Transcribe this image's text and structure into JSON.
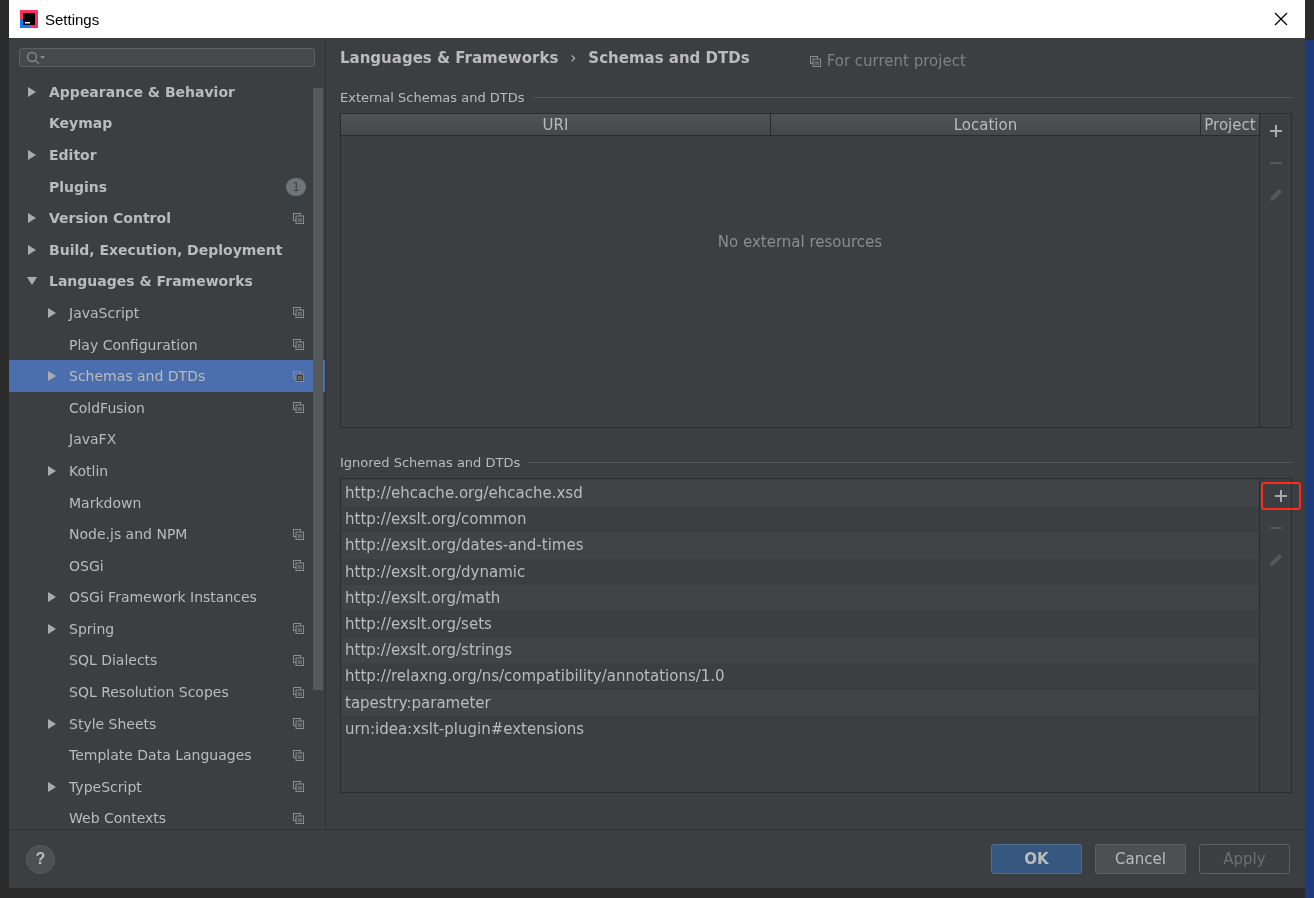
{
  "window": {
    "title": "Settings"
  },
  "sidebar": {
    "items": [
      {
        "label": "Appearance & Behavior",
        "expanded": false,
        "selected": false
      },
      {
        "label": "Keymap",
        "selected": false
      },
      {
        "label": "Editor",
        "expanded": false,
        "selected": false
      },
      {
        "label": "Plugins",
        "badge": "1",
        "selected": false
      },
      {
        "label": "Version Control",
        "expanded": false,
        "selected": false,
        "project_scope": true
      },
      {
        "label": "Build, Execution, Deployment",
        "expanded": false,
        "selected": false
      },
      {
        "label": "Languages & Frameworks",
        "expanded": true,
        "selected": false,
        "children": [
          {
            "label": "JavaScript",
            "expanded": false,
            "selected": false,
            "project_scope": true
          },
          {
            "label": "Play Configuration",
            "selected": false,
            "project_scope": true
          },
          {
            "label": "Schemas and DTDs",
            "expanded": false,
            "selected": true,
            "project_scope": true
          },
          {
            "label": "ColdFusion",
            "selected": false,
            "project_scope": true
          },
          {
            "label": "JavaFX",
            "selected": false
          },
          {
            "label": "Kotlin",
            "expanded": false,
            "selected": false
          },
          {
            "label": "Markdown",
            "selected": false
          },
          {
            "label": "Node.js and NPM",
            "selected": false,
            "project_scope": true
          },
          {
            "label": "OSGi",
            "selected": false,
            "project_scope": true
          },
          {
            "label": "OSGi Framework Instances",
            "expanded": false,
            "selected": false
          },
          {
            "label": "Spring",
            "expanded": false,
            "selected": false,
            "project_scope": true
          },
          {
            "label": "SQL Dialects",
            "selected": false,
            "project_scope": true
          },
          {
            "label": "SQL Resolution Scopes",
            "selected": false,
            "project_scope": true
          },
          {
            "label": "Style Sheets",
            "expanded": false,
            "selected": false,
            "project_scope": true
          },
          {
            "label": "Template Data Languages",
            "selected": false,
            "project_scope": true
          },
          {
            "label": "TypeScript",
            "expanded": false,
            "selected": false,
            "project_scope": true
          },
          {
            "label": "Web Contexts",
            "selected": false,
            "project_scope": true
          }
        ]
      }
    ]
  },
  "breadcrumb": [
    "Languages & Frameworks",
    "Schemas and DTDs"
  ],
  "breadcrumb_separator": "›",
  "scope_note": "For current project",
  "external_section": {
    "title": "External Schemas and DTDs",
    "columns": [
      "URI",
      "Location",
      "Project"
    ],
    "empty_text": "No external resources",
    "toolbar": [
      {
        "kind": "add",
        "disabled": false,
        "highlighted": false
      },
      {
        "kind": "remove",
        "disabled": true,
        "highlighted": false
      },
      {
        "kind": "edit",
        "disabled": true,
        "highlighted": false
      }
    ]
  },
  "ignored_section": {
    "title": "Ignored Schemas and DTDs",
    "rows": [
      "http://ehcache.org/ehcache.xsd",
      "http://exslt.org/common",
      "http://exslt.org/dates-and-times",
      "http://exslt.org/dynamic",
      "http://exslt.org/math",
      "http://exslt.org/sets",
      "http://exslt.org/strings",
      "http://relaxng.org/ns/compatibility/annotations/1.0",
      "tapestry:parameter",
      "urn:idea:xslt-plugin#extensions"
    ],
    "toolbar": [
      {
        "kind": "add",
        "disabled": false,
        "highlighted": true
      },
      {
        "kind": "remove",
        "disabled": true,
        "highlighted": false
      },
      {
        "kind": "edit",
        "disabled": true,
        "highlighted": false
      }
    ]
  },
  "help_button": "?",
  "buttons": [
    {
      "label": "OK",
      "kind": "default",
      "disabled": false
    },
    {
      "label": "Cancel",
      "kind": "normal",
      "disabled": false
    },
    {
      "label": "Apply",
      "kind": "normal",
      "disabled": true
    }
  ]
}
